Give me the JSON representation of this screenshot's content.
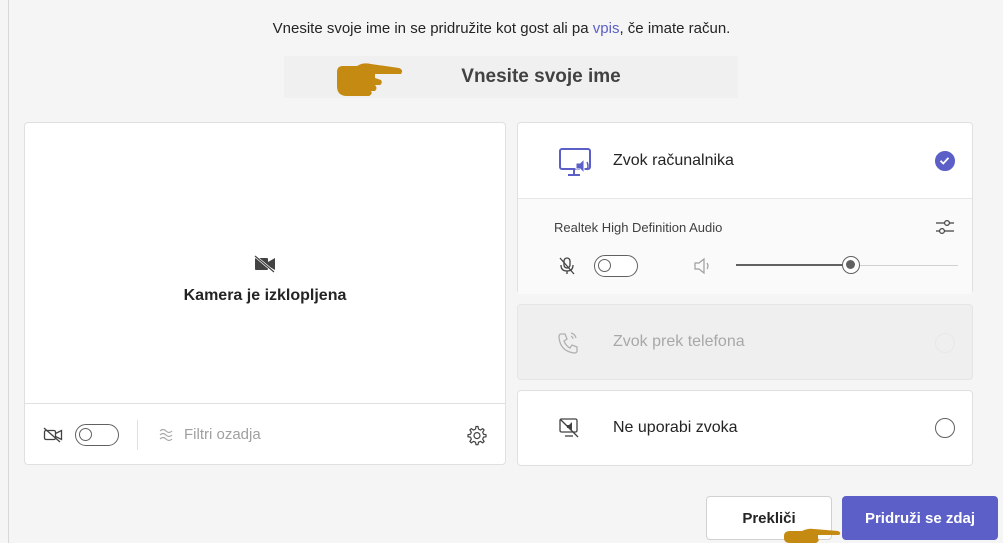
{
  "intro": {
    "text_before": "Vnesite svoje ime in se pridružite kot gost ali pa ",
    "link_text": "vpis",
    "text_after": ", če imate račun."
  },
  "name_input": {
    "placeholder": "Vnesite svoje ime",
    "value": ""
  },
  "camera": {
    "off_text": "Kamera je izklopljena",
    "camera_toggle_on": false,
    "filters_label": "Filtri ozadja"
  },
  "audio": {
    "computer": {
      "label": "Zvok računalnika",
      "selected": true,
      "device_name": "Realtek High Definition Audio",
      "mic_toggle_on": false,
      "volume": 0.52
    },
    "phone": {
      "label": "Zvok prek telefona",
      "disabled": true
    },
    "none": {
      "label": "Ne uporabi zvoka",
      "selected": false
    }
  },
  "buttons": {
    "cancel": "Prekliči",
    "join": "Pridruži se zdaj"
  },
  "colors": {
    "accent": "#5b5fc7",
    "annotation_hand": "#c48a12"
  },
  "icons": {
    "camera_off": "camera-off-icon",
    "computer_audio": "computer-audio-icon",
    "phone_audio": "phone-audio-icon",
    "no_audio": "no-audio-icon",
    "settings": "gear-icon",
    "device_settings": "sliders-icon",
    "mic_muted": "mic-off-icon",
    "speaker": "speaker-icon",
    "background_filters": "background-filters-icon",
    "pointing_hand": "pointing-hand-icon"
  }
}
